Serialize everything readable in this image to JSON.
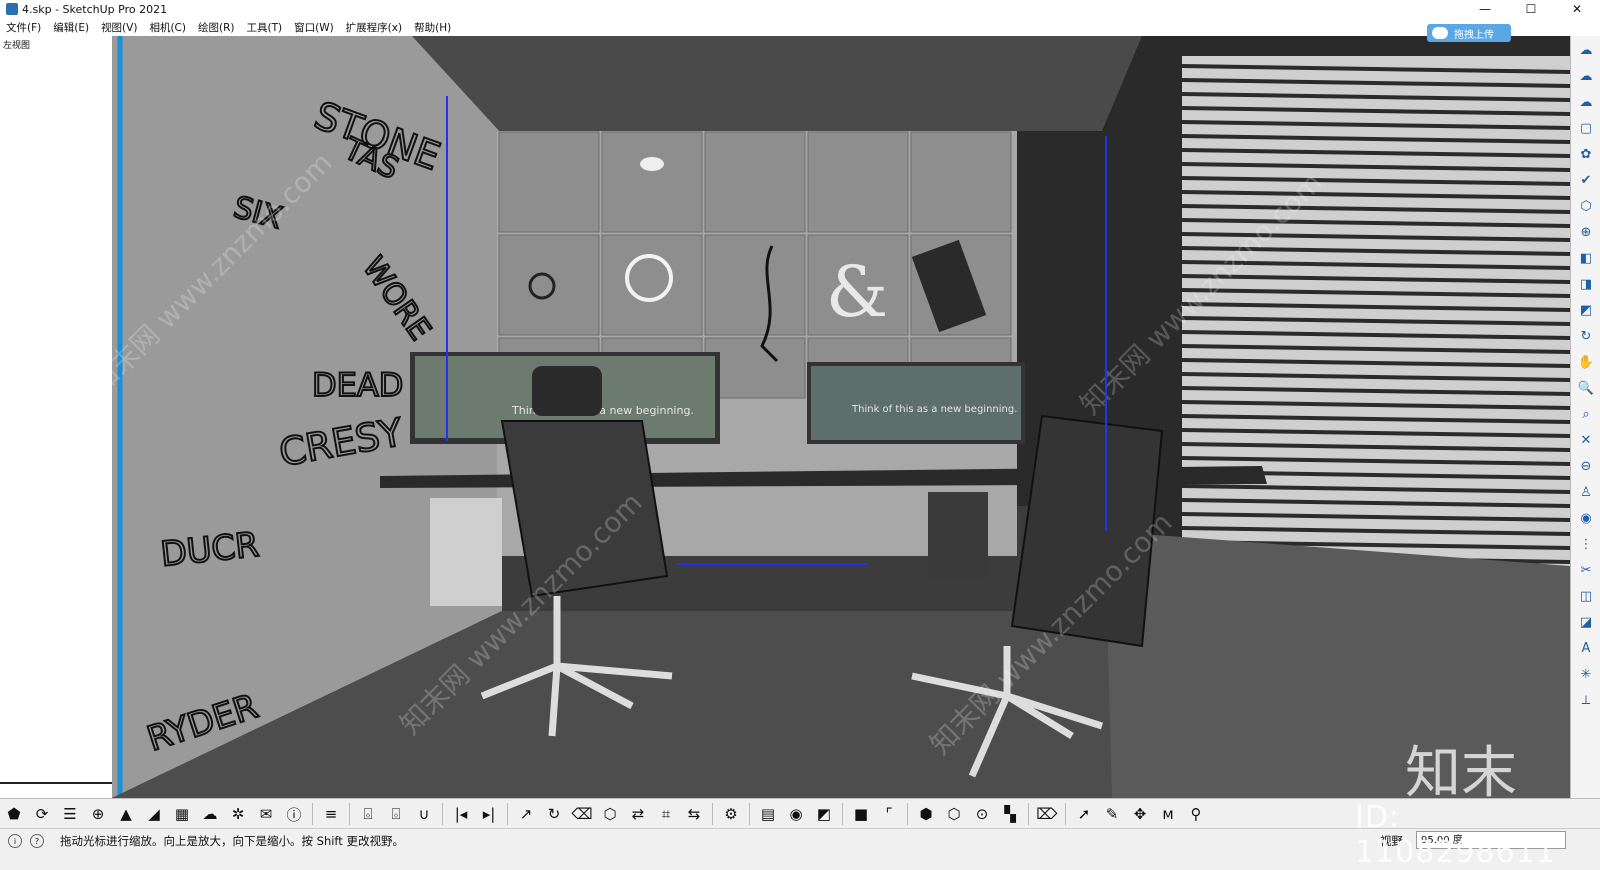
{
  "window": {
    "title": "4.skp - SketchUp Pro 2021",
    "minimize": "—",
    "maximize": "☐",
    "close": "✕"
  },
  "menu": [
    "文件(F)",
    "编辑(E)",
    "视图(V)",
    "相机(C)",
    "绘图(R)",
    "工具(T)",
    "窗口(W)",
    "扩展程序(x)",
    "帮助(H)"
  ],
  "left_panel": {
    "label": "左视图"
  },
  "upload_button": {
    "label": "拖拽上传"
  },
  "scene": {
    "screen_text_1": "Think of this as a new beginning.",
    "screen_text_2": "Think of this as a new beginning.",
    "ampersand": "&",
    "graffiti": [
      "STONE",
      "DEAD",
      "CRESY",
      "RYDER",
      "SIX",
      "WORE",
      "TAS",
      "DUCR"
    ],
    "watermarks": [
      "知末网 www.znzmo.com",
      "知末网 www.znzmo.com",
      "知末网 www.znzmo.com",
      "知末网 www.znzmo.com"
    ]
  },
  "watermark_logo": "知末",
  "watermark_id": "ID: 1108298611",
  "right_toolbar_icons": [
    "cloud-icon",
    "cloud-sync-icon",
    "cloud-upload-icon",
    "select-box-icon",
    "component-icon",
    "check-icon",
    "package-icon",
    "move-axis-icon",
    "cube-view-icon",
    "cube-top-icon",
    "cube-front-icon",
    "orbit-icon",
    "pan-icon",
    "zoom-icon",
    "zoom-window-icon",
    "zoom-extents-icon",
    "zoom-previous-icon",
    "position-camera-icon",
    "look-around-icon",
    "walk-icon",
    "section-plane-icon",
    "section-display-icon",
    "section-fill-icon",
    "text-icon",
    "axes-icon",
    "dimension-icon"
  ],
  "bottom_toolbar": [
    {
      "icon": "warehouse-icon",
      "glyph": "⬟"
    },
    {
      "icon": "refresh-icon",
      "glyph": "⟳"
    },
    {
      "icon": "layers-icon",
      "glyph": "☰"
    },
    {
      "icon": "add-circle-icon",
      "glyph": "⊕"
    },
    {
      "icon": "tree-icon",
      "glyph": "▲"
    },
    {
      "icon": "chart-icon",
      "glyph": "◢"
    },
    {
      "icon": "checker-icon",
      "glyph": "▦"
    },
    {
      "icon": "cloud-upload-icon",
      "glyph": "☁"
    },
    {
      "icon": "gear-group-icon",
      "glyph": "✲"
    },
    {
      "icon": "mail-icon",
      "glyph": "✉"
    },
    {
      "icon": "info-icon",
      "glyph": "ⓘ"
    },
    {
      "icon": "list-icon",
      "glyph": "≡"
    },
    {
      "icon": "basket-red-icon",
      "glyph": "⌺"
    },
    {
      "icon": "basket-blue-icon",
      "glyph": "⌺"
    },
    {
      "icon": "magnet-icon",
      "glyph": "∪"
    },
    {
      "icon": "prev-icon",
      "glyph": "|◂"
    },
    {
      "icon": "next-icon",
      "glyph": "▸|"
    },
    {
      "icon": "export-icon",
      "glyph": "↗"
    },
    {
      "icon": "rotate-icon",
      "glyph": "↻"
    },
    {
      "icon": "trash-icon",
      "glyph": "⌫"
    },
    {
      "icon": "box-icon",
      "glyph": "⬡"
    },
    {
      "icon": "shuffle-icon",
      "glyph": "⇄"
    },
    {
      "icon": "crop-icon",
      "glyph": "⌗"
    },
    {
      "icon": "swap-icon",
      "glyph": "⇆"
    },
    {
      "icon": "settings-icon",
      "glyph": "⚙"
    },
    {
      "icon": "notes-icon",
      "glyph": "▤"
    },
    {
      "icon": "bulb-icon",
      "glyph": "◉"
    },
    {
      "icon": "contrast-icon",
      "glyph": "◩"
    },
    {
      "icon": "square-blue-icon",
      "glyph": "■"
    },
    {
      "icon": "corners-icon",
      "glyph": "⌜"
    },
    {
      "icon": "hexagon-icon",
      "glyph": "⬢"
    },
    {
      "icon": "hexagon-outline-icon",
      "glyph": "⬡"
    },
    {
      "icon": "node-icon",
      "glyph": "⊙"
    },
    {
      "icon": "grid-icon",
      "glyph": "▚"
    },
    {
      "icon": "eraser-icon",
      "glyph": "⌦"
    },
    {
      "icon": "select-arrow-icon",
      "glyph": "➚"
    },
    {
      "icon": "pencil-icon",
      "glyph": "✎"
    },
    {
      "icon": "move-icon",
      "glyph": "✥"
    },
    {
      "icon": "tape-icon",
      "glyph": "ᴍ"
    },
    {
      "icon": "person-icon",
      "glyph": "⚲"
    }
  ],
  "status": {
    "message": "拖动光标进行缩放。向上是放大，向下是缩小。按 Shift 更改视野。",
    "view_label": "视野",
    "view_value": "95.00 度"
  },
  "colors": {
    "accent_blue": "#1d5fa8",
    "upload_blue": "#5aa7e6"
  }
}
